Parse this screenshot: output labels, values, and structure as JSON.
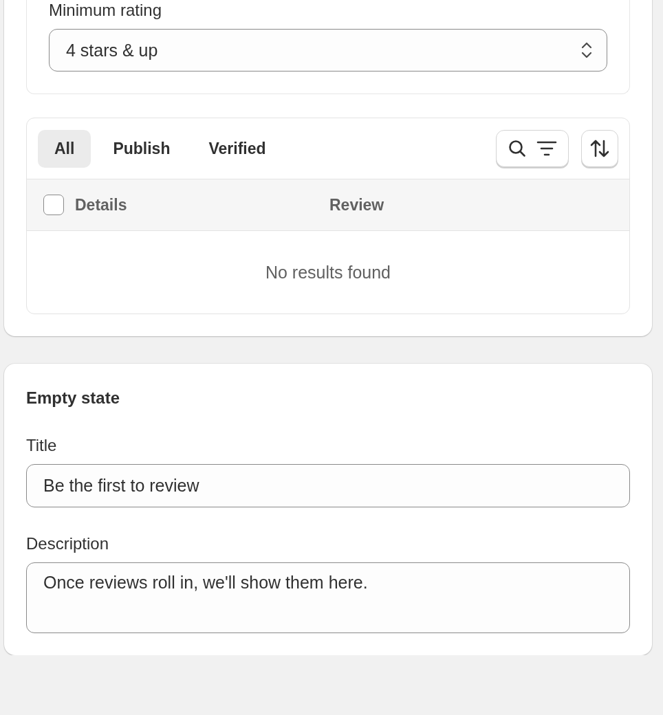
{
  "rating_filter": {
    "label": "Minimum rating",
    "value": "4 stars & up"
  },
  "review_table": {
    "tabs": [
      {
        "label": "All",
        "selected": true
      },
      {
        "label": "Publish",
        "selected": false
      },
      {
        "label": "Verified",
        "selected": false
      }
    ],
    "select_all": {
      "checked": false
    },
    "columns": [
      "Details",
      "Review"
    ],
    "empty_message": "No results found"
  },
  "empty_state": {
    "heading": "Empty state",
    "fields": [
      {
        "kind": "input",
        "label": "Title",
        "value": "Be the first to review"
      },
      {
        "kind": "textarea",
        "label": "Description",
        "value": "Once reviews roll in, we'll show them here."
      }
    ]
  }
}
